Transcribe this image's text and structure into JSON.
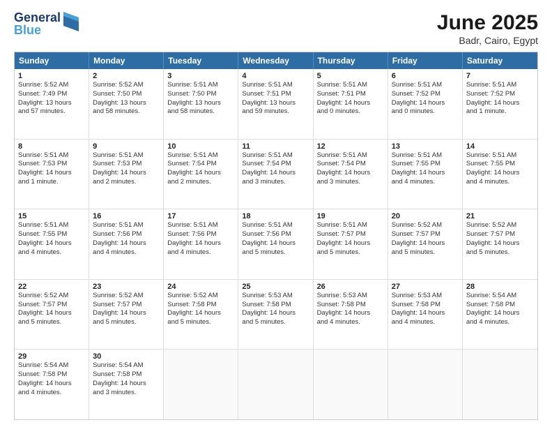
{
  "logo": {
    "line1": "General",
    "line2": "Blue"
  },
  "title": "June 2025",
  "subtitle": "Badr, Cairo, Egypt",
  "headers": [
    "Sunday",
    "Monday",
    "Tuesday",
    "Wednesday",
    "Thursday",
    "Friday",
    "Saturday"
  ],
  "weeks": [
    [
      {
        "day": "1",
        "info": "Sunrise: 5:52 AM\nSunset: 7:49 PM\nDaylight: 13 hours\nand 57 minutes."
      },
      {
        "day": "2",
        "info": "Sunrise: 5:52 AM\nSunset: 7:50 PM\nDaylight: 13 hours\nand 58 minutes."
      },
      {
        "day": "3",
        "info": "Sunrise: 5:51 AM\nSunset: 7:50 PM\nDaylight: 13 hours\nand 58 minutes."
      },
      {
        "day": "4",
        "info": "Sunrise: 5:51 AM\nSunset: 7:51 PM\nDaylight: 13 hours\nand 59 minutes."
      },
      {
        "day": "5",
        "info": "Sunrise: 5:51 AM\nSunset: 7:51 PM\nDaylight: 14 hours\nand 0 minutes."
      },
      {
        "day": "6",
        "info": "Sunrise: 5:51 AM\nSunset: 7:52 PM\nDaylight: 14 hours\nand 0 minutes."
      },
      {
        "day": "7",
        "info": "Sunrise: 5:51 AM\nSunset: 7:52 PM\nDaylight: 14 hours\nand 1 minute."
      }
    ],
    [
      {
        "day": "8",
        "info": "Sunrise: 5:51 AM\nSunset: 7:53 PM\nDaylight: 14 hours\nand 1 minute."
      },
      {
        "day": "9",
        "info": "Sunrise: 5:51 AM\nSunset: 7:53 PM\nDaylight: 14 hours\nand 2 minutes."
      },
      {
        "day": "10",
        "info": "Sunrise: 5:51 AM\nSunset: 7:54 PM\nDaylight: 14 hours\nand 2 minutes."
      },
      {
        "day": "11",
        "info": "Sunrise: 5:51 AM\nSunset: 7:54 PM\nDaylight: 14 hours\nand 3 minutes."
      },
      {
        "day": "12",
        "info": "Sunrise: 5:51 AM\nSunset: 7:54 PM\nDaylight: 14 hours\nand 3 minutes."
      },
      {
        "day": "13",
        "info": "Sunrise: 5:51 AM\nSunset: 7:55 PM\nDaylight: 14 hours\nand 4 minutes."
      },
      {
        "day": "14",
        "info": "Sunrise: 5:51 AM\nSunset: 7:55 PM\nDaylight: 14 hours\nand 4 minutes."
      }
    ],
    [
      {
        "day": "15",
        "info": "Sunrise: 5:51 AM\nSunset: 7:55 PM\nDaylight: 14 hours\nand 4 minutes."
      },
      {
        "day": "16",
        "info": "Sunrise: 5:51 AM\nSunset: 7:56 PM\nDaylight: 14 hours\nand 4 minutes."
      },
      {
        "day": "17",
        "info": "Sunrise: 5:51 AM\nSunset: 7:56 PM\nDaylight: 14 hours\nand 4 minutes."
      },
      {
        "day": "18",
        "info": "Sunrise: 5:51 AM\nSunset: 7:56 PM\nDaylight: 14 hours\nand 5 minutes."
      },
      {
        "day": "19",
        "info": "Sunrise: 5:51 AM\nSunset: 7:57 PM\nDaylight: 14 hours\nand 5 minutes."
      },
      {
        "day": "20",
        "info": "Sunrise: 5:52 AM\nSunset: 7:57 PM\nDaylight: 14 hours\nand 5 minutes."
      },
      {
        "day": "21",
        "info": "Sunrise: 5:52 AM\nSunset: 7:57 PM\nDaylight: 14 hours\nand 5 minutes."
      }
    ],
    [
      {
        "day": "22",
        "info": "Sunrise: 5:52 AM\nSunset: 7:57 PM\nDaylight: 14 hours\nand 5 minutes."
      },
      {
        "day": "23",
        "info": "Sunrise: 5:52 AM\nSunset: 7:57 PM\nDaylight: 14 hours\nand 5 minutes."
      },
      {
        "day": "24",
        "info": "Sunrise: 5:52 AM\nSunset: 7:58 PM\nDaylight: 14 hours\nand 5 minutes."
      },
      {
        "day": "25",
        "info": "Sunrise: 5:53 AM\nSunset: 7:58 PM\nDaylight: 14 hours\nand 5 minutes."
      },
      {
        "day": "26",
        "info": "Sunrise: 5:53 AM\nSunset: 7:58 PM\nDaylight: 14 hours\nand 4 minutes."
      },
      {
        "day": "27",
        "info": "Sunrise: 5:53 AM\nSunset: 7:58 PM\nDaylight: 14 hours\nand 4 minutes."
      },
      {
        "day": "28",
        "info": "Sunrise: 5:54 AM\nSunset: 7:58 PM\nDaylight: 14 hours\nand 4 minutes."
      }
    ],
    [
      {
        "day": "29",
        "info": "Sunrise: 5:54 AM\nSunset: 7:58 PM\nDaylight: 14 hours\nand 4 minutes."
      },
      {
        "day": "30",
        "info": "Sunrise: 5:54 AM\nSunset: 7:58 PM\nDaylight: 14 hours\nand 3 minutes."
      },
      {
        "day": "",
        "info": ""
      },
      {
        "day": "",
        "info": ""
      },
      {
        "day": "",
        "info": ""
      },
      {
        "day": "",
        "info": ""
      },
      {
        "day": "",
        "info": ""
      }
    ]
  ]
}
